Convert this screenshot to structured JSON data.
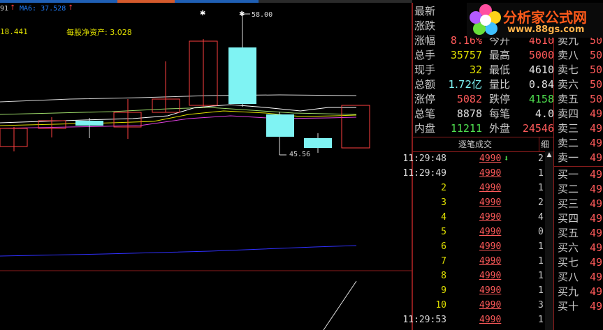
{
  "chart": {
    "ma_label": "91",
    "ma_label2": "MA6: 37.528",
    "value_left": "18.441",
    "net_asset_label": "每股净资产: 3.028",
    "high_label": "58.00",
    "low_label": "45.56"
  },
  "quote": {
    "rows": [
      {
        "l": "最新",
        "v": "",
        "l2": "",
        "v2": ""
      },
      {
        "l": "涨跌",
        "v": "",
        "l2": "",
        "v2": ""
      },
      {
        "l": "涨幅",
        "v": "8.16%",
        "l2": "今开",
        "v2": "4610"
      },
      {
        "l": "总手",
        "v": "35757",
        "l2": "最高",
        "v2": "5000"
      },
      {
        "l": "现手",
        "v": "32",
        "l2": "最低",
        "v2": "4610"
      },
      {
        "l": "总额",
        "v": "1.72亿",
        "l2": "量比",
        "v2": "0.84"
      },
      {
        "l": "涨停",
        "v": "5082",
        "l2": "跌停",
        "v2": "4158"
      },
      {
        "l": "总笔",
        "v": "8878",
        "l2": "每笔",
        "v2": "4.0"
      },
      {
        "l": "内盘",
        "v": "11211",
        "l2": "外盘",
        "v2": "24546"
      }
    ]
  },
  "ticks": {
    "title": "逐笔成交",
    "detail_label": "细",
    "rows": [
      {
        "time": "11:29:48",
        "price": "4990",
        "vol": "2"
      },
      {
        "time": "11:29:49",
        "price": "4990",
        "vol": "1"
      },
      {
        "time": "2",
        "price": "4990",
        "vol": "1"
      },
      {
        "time": "3",
        "price": "4990",
        "vol": "2"
      },
      {
        "time": "4",
        "price": "4990",
        "vol": "4"
      },
      {
        "time": "5",
        "price": "4990",
        "vol": "0"
      },
      {
        "time": "6",
        "price": "4990",
        "vol": "1"
      },
      {
        "time": "7",
        "price": "4990",
        "vol": "1"
      },
      {
        "time": "8",
        "price": "4990",
        "vol": "1"
      },
      {
        "time": "9",
        "price": "4990",
        "vol": "1"
      },
      {
        "time": "10",
        "price": "4990",
        "vol": "3"
      },
      {
        "time": "11:29:53",
        "price": "4990",
        "vol": "1"
      }
    ]
  },
  "book": {
    "sells": [
      {
        "label": "卖九",
        "price": "50"
      },
      {
        "label": "卖八",
        "price": "50"
      },
      {
        "label": "卖七",
        "price": "50"
      },
      {
        "label": "卖六",
        "price": "50"
      },
      {
        "label": "卖五",
        "price": "50"
      },
      {
        "label": "卖四",
        "price": "49"
      },
      {
        "label": "卖三",
        "price": "49"
      },
      {
        "label": "卖二",
        "price": "49"
      },
      {
        "label": "卖一",
        "price": "49"
      }
    ],
    "buys": [
      {
        "label": "买一",
        "price": "49"
      },
      {
        "label": "买二",
        "price": "49"
      },
      {
        "label": "买三",
        "price": "49"
      },
      {
        "label": "买四",
        "price": "49"
      },
      {
        "label": "买五",
        "price": "49"
      },
      {
        "label": "买六",
        "price": "49"
      },
      {
        "label": "买七",
        "price": "49"
      },
      {
        "label": "买八",
        "price": "49"
      },
      {
        "label": "买九",
        "price": "49"
      },
      {
        "label": "买十",
        "price": "49"
      }
    ]
  },
  "logo": {
    "title": "分析家公式网",
    "url": "www.88gs.com"
  }
}
